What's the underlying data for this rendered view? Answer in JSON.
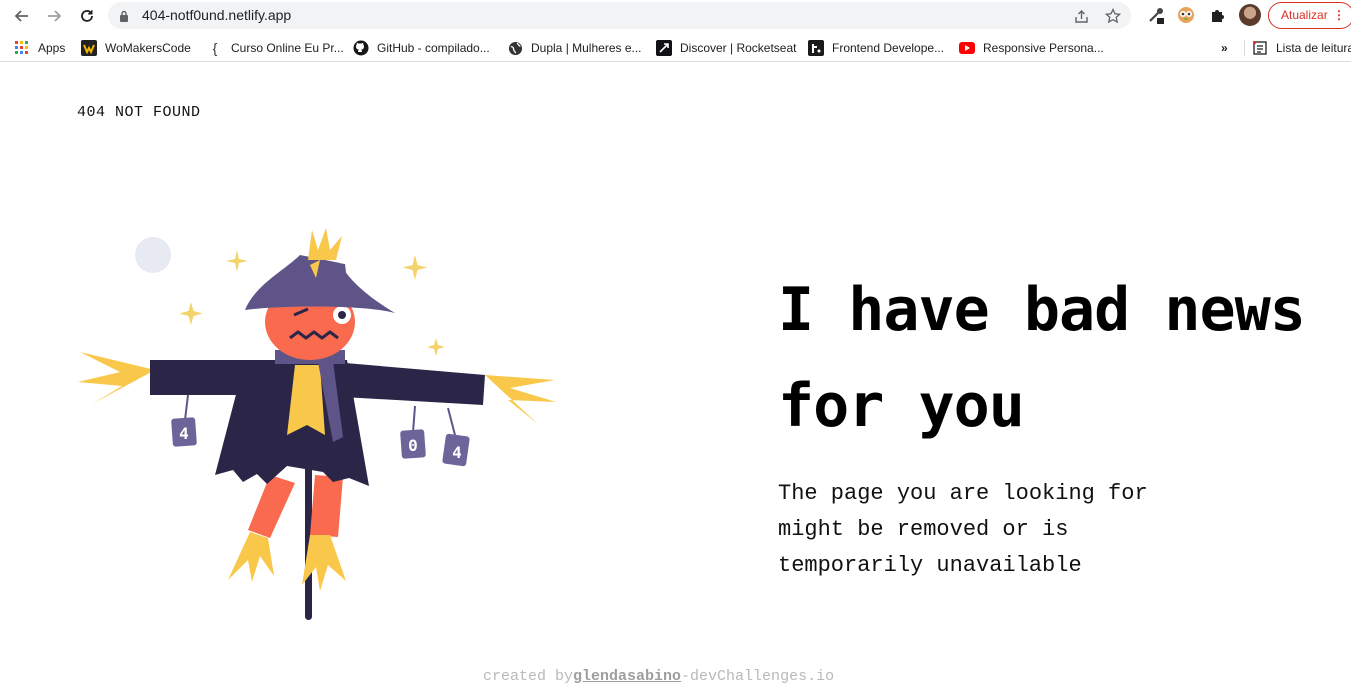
{
  "browser": {
    "url": "404-notf0und.netlify.app",
    "update_label": "Atualizar",
    "update_menu": "⋮",
    "overflow_label": "»",
    "reading_list_label": "Lista de leitura"
  },
  "bookmarks": [
    {
      "label": "Apps",
      "icon": "apps-grid-icon"
    },
    {
      "label": "WoMakersCode",
      "icon": "womakerscode-icon"
    },
    {
      "label": "Curso Online Eu Pr...",
      "icon": "curly-brace-icon",
      "icon_text": "{"
    },
    {
      "label": "GitHub - compilado...",
      "icon": "github-icon"
    },
    {
      "label": "Dupla | Mulheres e...",
      "icon": "globe-icon"
    },
    {
      "label": "Discover | Rocketseat",
      "icon": "rocketseat-icon"
    },
    {
      "label": "Frontend Develope...",
      "icon": "frontend-mentor-icon"
    },
    {
      "label": "Responsive Persona...",
      "icon": "youtube-icon"
    }
  ],
  "page": {
    "logo": "404 NOT FOUND",
    "headline": "I have bad news for you",
    "description": "The page you are looking for might be removed or is temporarily unavailable",
    "footer_prefix": "created by",
    "footer_author": "glendasabino",
    "footer_suffix": "-devChallenges.io"
  },
  "illustration": {
    "subject": "scarecrow",
    "sign_digits": [
      "4",
      "0",
      "4"
    ]
  },
  "colors": {
    "accent_red": "#d93025",
    "hat": "#5e5488",
    "coat": "#2b2648",
    "face": "#f96a4f",
    "straw": "#f9c84a",
    "sparkle": "#f4d36b",
    "moon": "#e7eaf3"
  }
}
